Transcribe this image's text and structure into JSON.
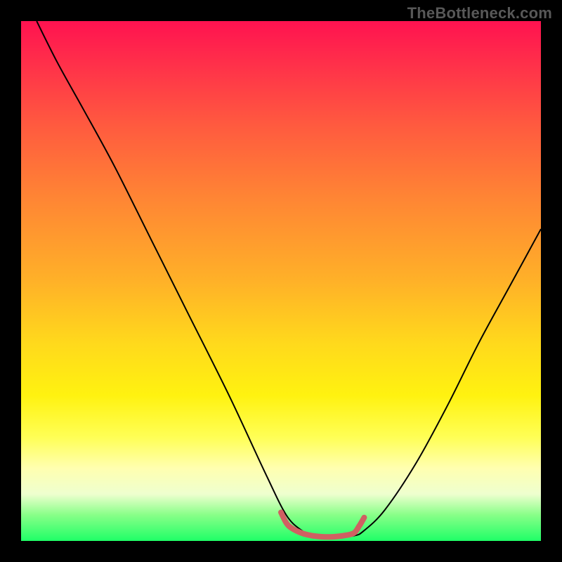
{
  "watermark": "TheBottleneck.com",
  "chart_data": {
    "type": "line",
    "title": "",
    "xlabel": "",
    "ylabel": "",
    "xlim": [
      0,
      100
    ],
    "ylim": [
      0,
      100
    ],
    "gradient_stops": [
      {
        "pct": 0,
        "color": "#ff1250"
      },
      {
        "pct": 8,
        "color": "#ff2f4a"
      },
      {
        "pct": 20,
        "color": "#ff5a3f"
      },
      {
        "pct": 34,
        "color": "#ff8534"
      },
      {
        "pct": 50,
        "color": "#ffb128"
      },
      {
        "pct": 62,
        "color": "#ffd91c"
      },
      {
        "pct": 72,
        "color": "#fff210"
      },
      {
        "pct": 80,
        "color": "#ffff55"
      },
      {
        "pct": 86,
        "color": "#ffffb0"
      },
      {
        "pct": 91,
        "color": "#eeffcf"
      },
      {
        "pct": 95,
        "color": "#88ff88"
      },
      {
        "pct": 100,
        "color": "#1fff67"
      }
    ],
    "series": [
      {
        "name": "bottleneck-curve",
        "stroke": "#000000",
        "stroke_width": 2,
        "x": [
          3,
          7,
          12,
          18,
          25,
          32,
          40,
          47,
          51,
          54,
          56,
          60,
          64,
          66,
          70,
          76,
          82,
          88,
          94,
          100
        ],
        "y": [
          100,
          92,
          83,
          72,
          58,
          44,
          28,
          13,
          5,
          2,
          1,
          1,
          1,
          2,
          6,
          15,
          26,
          38,
          49,
          60
        ]
      },
      {
        "name": "trough-marker",
        "stroke": "#d06062",
        "stroke_width": 8,
        "x": [
          50,
          51,
          52,
          54,
          56,
          58,
          60,
          62,
          64,
          65,
          66
        ],
        "y": [
          5.5,
          3.5,
          2.5,
          1.5,
          1.0,
          0.8,
          0.8,
          1.0,
          1.5,
          2.8,
          4.5
        ]
      }
    ]
  }
}
